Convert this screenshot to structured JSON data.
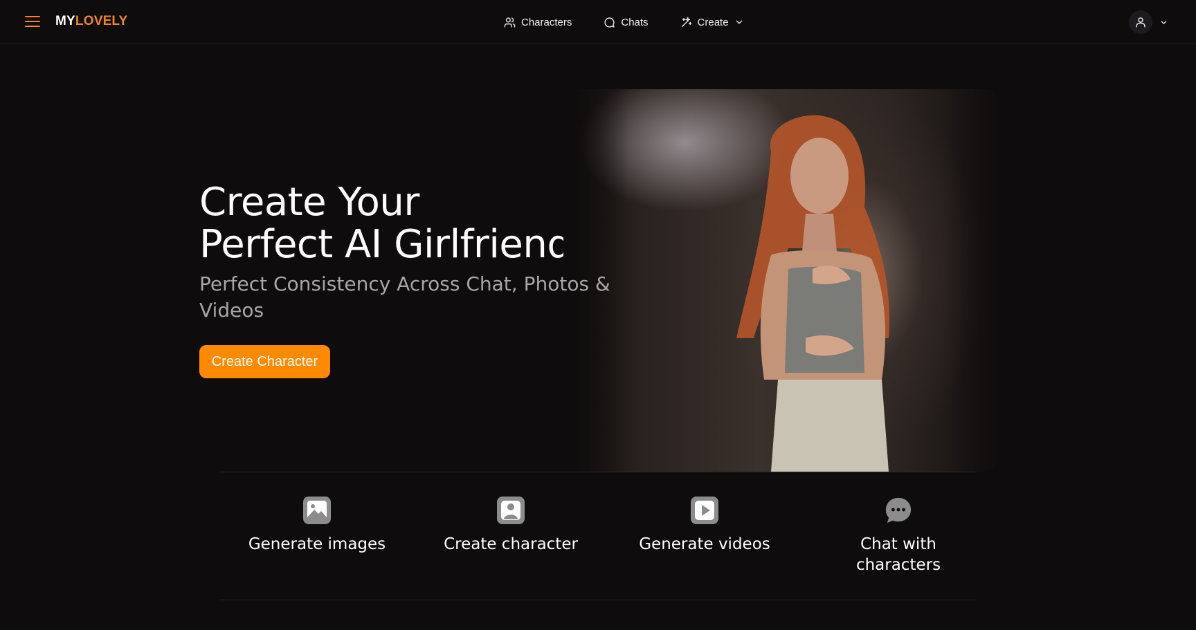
{
  "brand": {
    "part1": "MY",
    "part2": "LOVELY"
  },
  "nav": {
    "characters": "Characters",
    "chats": "Chats",
    "create": "Create"
  },
  "hero": {
    "title_line1": "Create Your",
    "title_line2": "Perfect AI Girlfriend",
    "subtitle": "Perfect Consistency Across Chat, Photos & Videos",
    "cta": "Create Character"
  },
  "features": [
    {
      "label": "Generate images",
      "icon": "image-icon"
    },
    {
      "label": "Create character",
      "icon": "person-portrait-icon"
    },
    {
      "label": "Generate videos",
      "icon": "play-icon"
    },
    {
      "label": "Chat with characters",
      "icon": "chat-bubble-icon"
    }
  ],
  "colors": {
    "background": "#0f0c0d",
    "accent": "#ff8a00",
    "brand_orange": "#f5841f",
    "muted_text": "#a9a5a8"
  }
}
